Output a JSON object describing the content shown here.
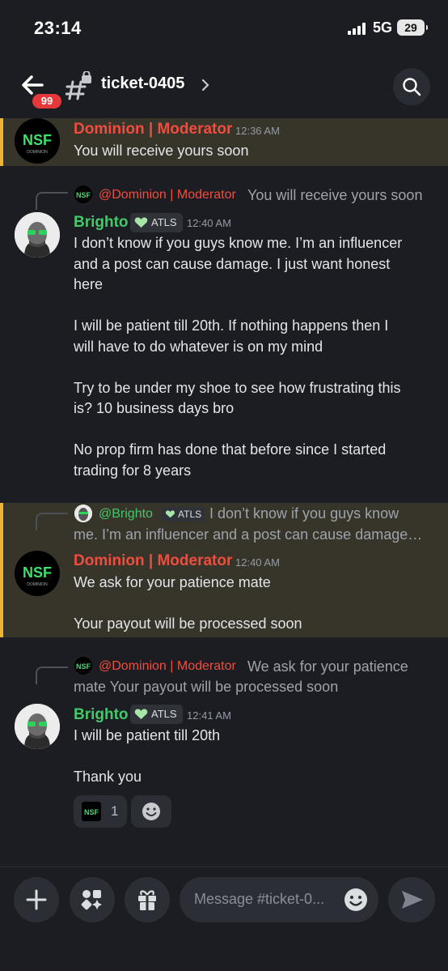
{
  "status_bar": {
    "time": "23:14",
    "network": "5G",
    "battery": "29"
  },
  "header": {
    "badge_count": "99",
    "channel_name": "ticket-0405"
  },
  "messages": [
    {
      "author": "Dominion | Moderator",
      "time": "12:36 AM",
      "text": "You will receive yours soon",
      "highlighted": true,
      "avatar": "NSF"
    },
    {
      "reply": {
        "author": "@Dominion | Moderator",
        "text": "You will receive yours soon"
      },
      "author": "Brighto",
      "tag": "ATLS",
      "time": "12:40 AM",
      "text": "I don’t know if you guys know me. I’m an influencer\nand a post can cause damage. I just want honest\nhere\n\nI will be patient till 20th. If nothing happens then I\nwill have to do whatever is on my mind\n\nTry to be under my shoe to see how frustrating this\nis? 10 business days bro\n\nNo prop firm has done that before since I started\ntrading for 8 years"
    },
    {
      "reply": {
        "author": "@Brighto",
        "tag": "ATLS",
        "text_line1": "I don’t know if you guys know",
        "text_line2": "me. I’m an influencer and a post can cause damage…"
      },
      "author": "Dominion | Moderator",
      "time": "12:40 AM",
      "text": "We ask for your patience mate\n\nYour payout will be processed soon",
      "highlighted": true
    },
    {
      "reply": {
        "author": "@Dominion | Moderator",
        "text_line1": "We ask for your patience",
        "text_line2": "mate   Your payout will be processed soon"
      },
      "author": "Brighto",
      "tag": "ATLS",
      "time": "12:41 AM",
      "text": "I will be patient till 20th\n\nThank you",
      "reaction": {
        "emoji": "NSF",
        "count": "1"
      }
    }
  ],
  "composer": {
    "placeholder": "Message #ticket-0..."
  },
  "colors": {
    "moderator": "#f04d3f",
    "user": "#43c86a",
    "highlight_bar": "#f0b232",
    "badge": "#e5383b"
  }
}
